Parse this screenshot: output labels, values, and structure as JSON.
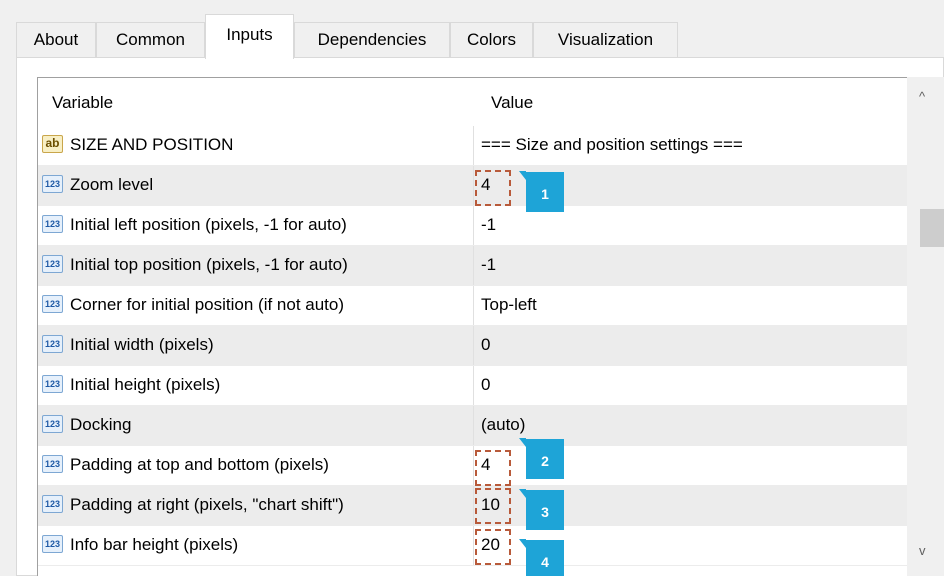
{
  "tabs": [
    {
      "label": "About"
    },
    {
      "label": "Common"
    },
    {
      "label": "Inputs",
      "active": true
    },
    {
      "label": "Dependencies"
    },
    {
      "label": "Colors"
    },
    {
      "label": "Visualization"
    }
  ],
  "grid": {
    "columns": {
      "variable": "Variable",
      "value": "Value"
    },
    "rows": [
      {
        "icon": "ab",
        "variable": "SIZE AND POSITION",
        "value": "=== Size and position settings ==="
      },
      {
        "icon": "123",
        "variable": "Zoom level",
        "value": "4"
      },
      {
        "icon": "123",
        "variable": "Initial left position (pixels, -1 for auto)",
        "value": "-1"
      },
      {
        "icon": "123",
        "variable": "Initial top position (pixels, -1 for auto)",
        "value": "-1"
      },
      {
        "icon": "123",
        "variable": "Corner for initial position (if not auto)",
        "value": "Top-left"
      },
      {
        "icon": "123",
        "variable": "Initial width (pixels)",
        "value": "0"
      },
      {
        "icon": "123",
        "variable": "Initial height (pixels)",
        "value": "0"
      },
      {
        "icon": "123",
        "variable": "Docking",
        "value": "(auto)"
      },
      {
        "icon": "123",
        "variable": "Padding at top and bottom (pixels)",
        "value": "4"
      },
      {
        "icon": "123",
        "variable": "Padding at right (pixels, \"chart shift\")",
        "value": "10"
      },
      {
        "icon": "123",
        "variable": "Info bar height (pixels)",
        "value": "20"
      }
    ]
  },
  "callouts": [
    "1",
    "2",
    "3",
    "4"
  ],
  "scrollbar": {
    "up": "^",
    "down": "v"
  },
  "colors": {
    "callout": "#1ea4d7",
    "highlight": "#b85a3a"
  }
}
